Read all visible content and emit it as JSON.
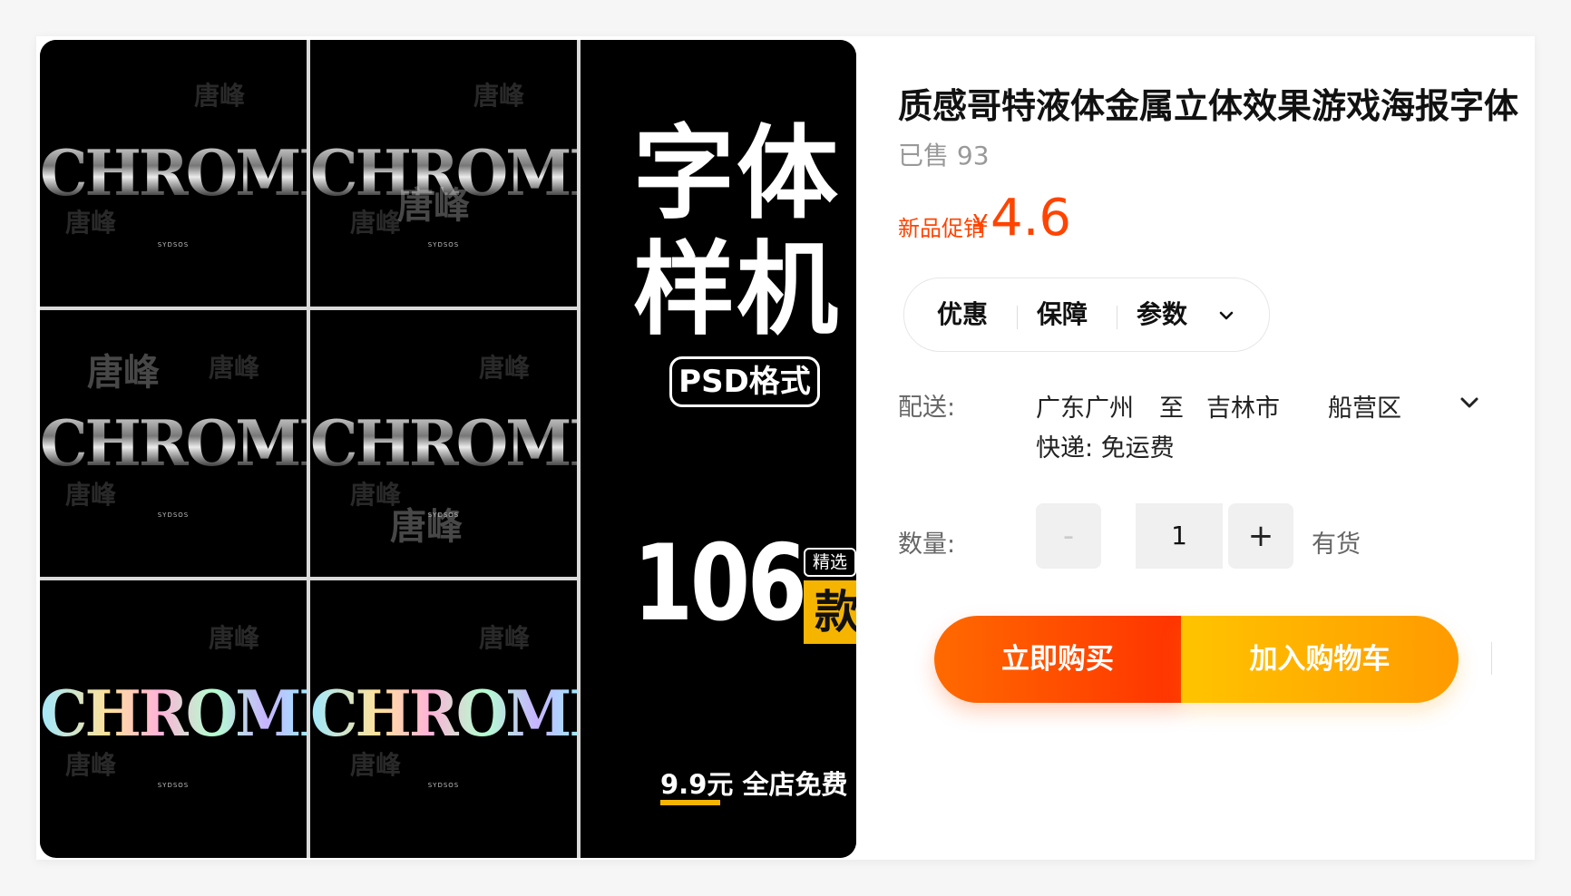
{
  "gallery": {
    "tiles": [
      {
        "art": "CHROME",
        "watermarks": [
          "唐峰",
          "唐峰"
        ],
        "holo": false
      },
      {
        "art": "CHROME",
        "watermarks": [
          "唐峰",
          "唐峰",
          "唐峰"
        ],
        "holo": false
      },
      {
        "art": "CHROME",
        "watermarks": [
          "唐峰",
          "唐峰",
          "唐峰"
        ],
        "holo": false
      },
      {
        "art": "CHROME",
        "watermarks": [
          "唐峰",
          "唐峰",
          "唐峰"
        ],
        "holo": false
      },
      {
        "art": "CHROME",
        "watermarks": [
          "唐峰",
          "唐峰"
        ],
        "holo": true
      },
      {
        "art": "CHROME",
        "watermarks": [
          "唐峰",
          "唐峰"
        ],
        "holo": true
      }
    ],
    "tiny_caption": "SYDSOS",
    "promo": {
      "line1": "字体",
      "line2": "样机",
      "format_badge": "PSD格式",
      "count": "106",
      "count_tag": "精选",
      "count_unit": "款",
      "footer": "9.9元 全店免费",
      "accent_color": "#f5b400"
    }
  },
  "product": {
    "title": "质感哥特液体金属立体效果游戏海报字体",
    "sold": "已售 93",
    "price_label": "新品促销",
    "currency": "¥",
    "price": "4.6",
    "price_color": "#ff4400"
  },
  "tabs": {
    "discount": "优惠",
    "guarantee": "保障",
    "params": "参数",
    "params_icon": "chevron-down-icon"
  },
  "shipping": {
    "label": "配送:",
    "from": "广东广州",
    "to_word": "至",
    "city": "吉林市",
    "district": "船营区",
    "method": "快递: 免运费"
  },
  "quantity": {
    "label": "数量:",
    "minus": "-",
    "value": "1",
    "plus": "+",
    "stock": "有货"
  },
  "actions": {
    "buy_now": "立即购买",
    "add_to_cart": "加入购物车",
    "favorite_icon": "star-icon"
  }
}
